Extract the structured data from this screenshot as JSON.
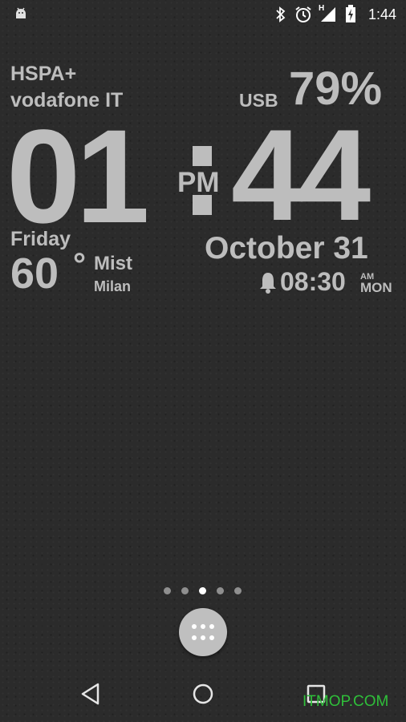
{
  "status_bar": {
    "time": "1:44",
    "network_type": "H",
    "icons": [
      "android-icon",
      "bluetooth-icon",
      "alarm-icon",
      "signal-icon",
      "battery-charging-icon"
    ]
  },
  "widget": {
    "network": "HSPA+",
    "carrier": "vodafone IT",
    "power_source": "USB",
    "battery": "79%",
    "hours": "01",
    "minutes": "44",
    "ampm": "PM",
    "day": "Friday",
    "date": "October 31",
    "temperature": "60",
    "degree": "°",
    "condition": "Mist",
    "city": "Milan",
    "alarm_time": "08:30",
    "alarm_ampm": "AM",
    "alarm_day": "MON"
  },
  "home": {
    "page_count": 5,
    "active_page": 3,
    "app_drawer_icon": "apps-grid-icon"
  },
  "navigation": {
    "icons": [
      "back-icon",
      "home-icon",
      "recents-icon"
    ]
  },
  "watermark": "ITMOP.COM",
  "colors": {
    "text": "#bdbdbd",
    "background": "#2b2b2b",
    "watermark": "#2fbf3a"
  }
}
